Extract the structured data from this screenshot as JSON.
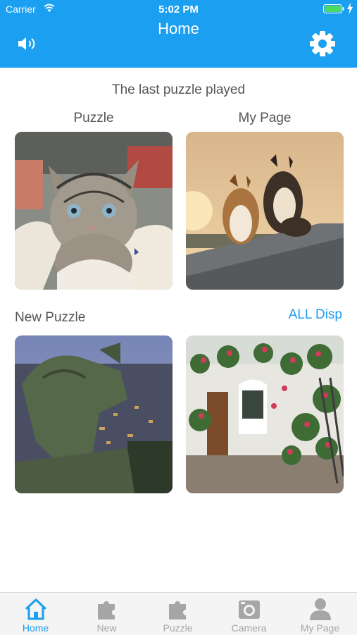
{
  "status_bar": {
    "carrier": "Carrier",
    "time": "5:02 PM"
  },
  "header": {
    "title": "Home"
  },
  "main": {
    "section_title": "The last puzzle played",
    "recent": [
      {
        "label": "Puzzle"
      },
      {
        "label": "My Page"
      }
    ],
    "new_puzzle_label": "New Puzzle",
    "all_link": "ALL Disp"
  },
  "tabbar": {
    "tabs": [
      {
        "label": "Home",
        "icon": "home-icon"
      },
      {
        "label": "New",
        "icon": "puzzle-piece-icon"
      },
      {
        "label": "Puzzle",
        "icon": "puzzle-piece-icon"
      },
      {
        "label": "Camera",
        "icon": "camera-icon"
      },
      {
        "label": "My Page",
        "icon": "person-icon"
      }
    ]
  },
  "colors": {
    "accent": "#1b9ff0",
    "inactive": "#a6a6a6"
  }
}
